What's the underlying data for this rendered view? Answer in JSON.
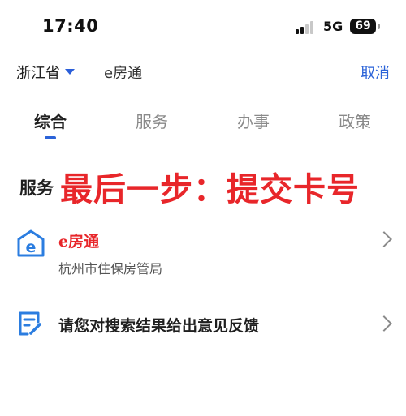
{
  "status_bar": {
    "time": "17:40",
    "network": "5G",
    "battery": "69"
  },
  "search": {
    "province": "浙江省",
    "query": "e房通",
    "cancel_label": "取消"
  },
  "tabs": [
    {
      "label": "综合",
      "active": true
    },
    {
      "label": "服务",
      "active": false
    },
    {
      "label": "办事",
      "active": false
    },
    {
      "label": "政策",
      "active": false
    }
  ],
  "section": {
    "title": "服务",
    "annotation": "最后一步：提交卡号"
  },
  "results": [
    {
      "title": "e房通",
      "subtitle": "杭州市住保房管局"
    }
  ],
  "feedback": {
    "label": "请您对搜索结果给出意见反馈"
  },
  "colors": {
    "accent": "#2b63d8",
    "annotation_red": "#e8262a"
  }
}
